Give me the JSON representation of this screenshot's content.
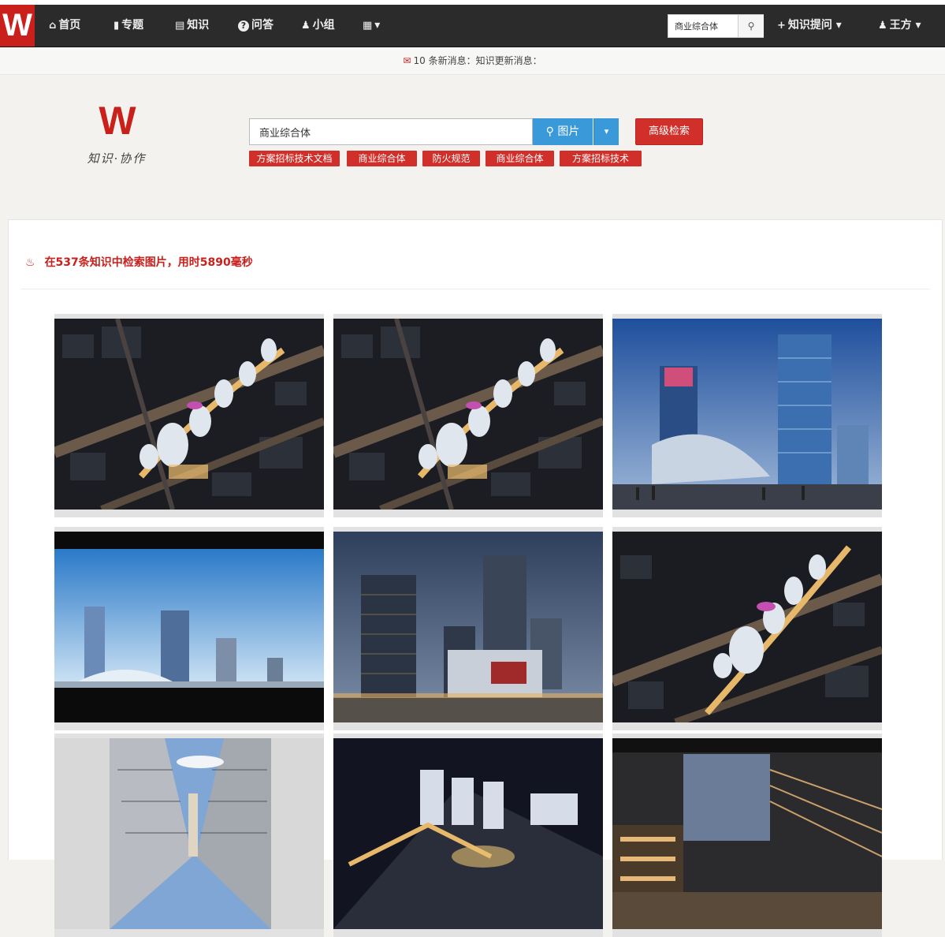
{
  "navbar": {
    "brand": "W",
    "items": [
      {
        "icon": "home-icon",
        "glyph": "⌂",
        "label": "首页"
      },
      {
        "icon": "bookmark-icon",
        "glyph": "▮",
        "label": "专题"
      },
      {
        "icon": "book-icon",
        "glyph": "▤",
        "label": "知识"
      },
      {
        "icon": "question-icon",
        "glyph": "?",
        "label": "问答"
      },
      {
        "icon": "group-icon",
        "glyph": "♟",
        "label": "小组"
      },
      {
        "icon": "grid-menu-icon",
        "glyph": "▦",
        "label": "▾"
      }
    ],
    "search_value": "商业综合体",
    "add_menu_label": "知识提问 ▾",
    "user_label": "王方 ▾"
  },
  "message_bar": {
    "text": "10 条新消息：知识更新消息："
  },
  "search": {
    "logo_mark": "W",
    "logo_sub": "知识·协作",
    "query": "商业综合体",
    "image_button_label": "图片",
    "advanced_label": "高级检索",
    "tags": [
      "方案招标技术文档",
      "商业综合体",
      "防火规范",
      "商业综合体",
      "方案招标技术"
    ]
  },
  "results": {
    "summary": "在537条知识中检索图片，用时5890毫秒"
  },
  "colors": {
    "brand_red": "#c9201c",
    "nav_bg": "#2b2b2b",
    "accent_blue": "#3a99d8"
  },
  "images": [
    {
      "scene": "aerial-night"
    },
    {
      "scene": "aerial-night"
    },
    {
      "scene": "towers-dusk"
    },
    {
      "scene": "skyline-blue"
    },
    {
      "scene": "tower-evening"
    },
    {
      "scene": "aerial-night"
    },
    {
      "scene": "twisted-tower"
    },
    {
      "scene": "aerial-night-2"
    },
    {
      "scene": "mall-interior"
    }
  ]
}
